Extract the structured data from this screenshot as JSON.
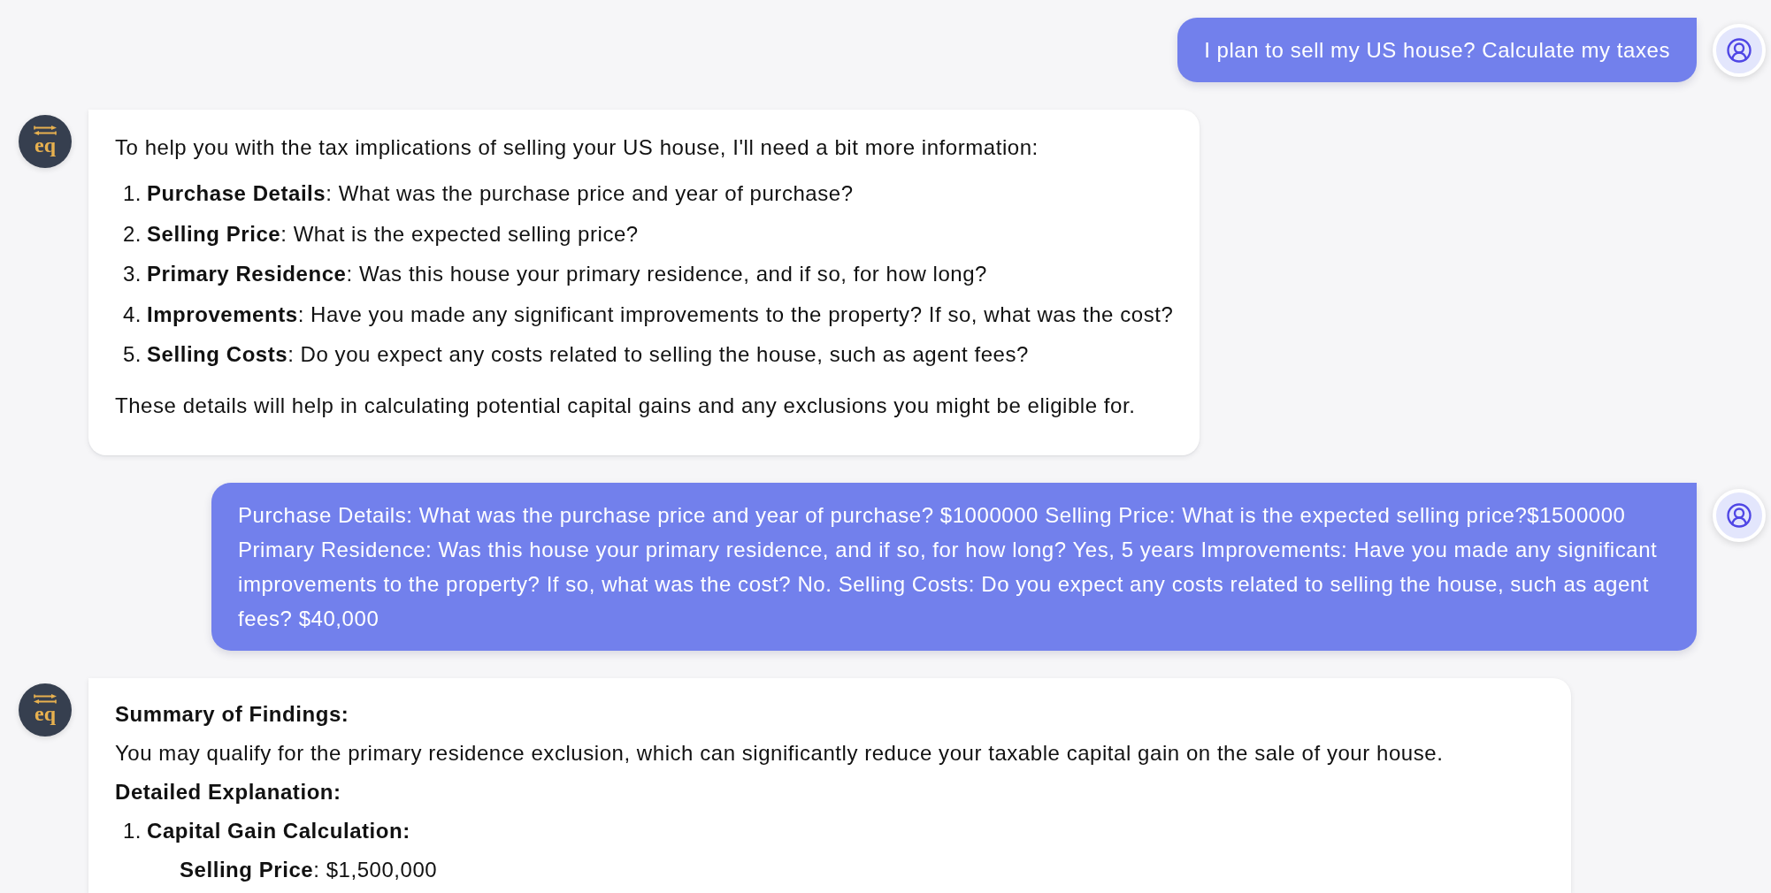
{
  "messages": [
    {
      "kind": "user",
      "text": "I plan to sell my US house? Calculate my taxes"
    },
    {
      "kind": "assistant",
      "avatar": {
        "logo_text": "eq"
      },
      "blocks": [
        {
          "kind": "paragraph",
          "text": "To help you with the tax implications of selling your US house, I'll need a bit more information:"
        },
        {
          "kind": "ordered_list",
          "items": [
            {
              "marker": "1.",
              "bold": false,
              "text": "**Purchase Details**: What was the purchase price and year of purchase?"
            },
            {
              "marker": "2.",
              "bold": false,
              "text": "**Selling Price**: What is the expected selling price?"
            },
            {
              "marker": "3.",
              "bold": false,
              "text": "**Primary Residence**: Was this house your primary residence, and if so, for how long?"
            },
            {
              "marker": "4.",
              "bold": false,
              "text": "**Improvements**: Have you made any significant improvements to the property? If so, what was the cost?"
            },
            {
              "marker": "5.",
              "bold": false,
              "text": "**Selling Costs**: Do you expect any costs related to selling the house, such as agent fees?"
            }
          ]
        },
        {
          "kind": "paragraph",
          "text": "These details will help in calculating potential capital gains and any exclusions you might be eligible for."
        }
      ]
    },
    {
      "kind": "user",
      "text": "Purchase Details: What was the purchase price and year of purchase? $1000000 Selling Price: What is the expected selling price?$1500000 Primary Residence: Was this house your primary residence, and if so, for how long? Yes, 5 years Improvements: Have you made any significant improvements to the property? If so, what was the cost? No. Selling Costs: Do you expect any costs related to selling the house, such as agent fees? $40,000"
    },
    {
      "kind": "assistant",
      "avatar": {
        "logo_text": "eq"
      },
      "blocks": [
        {
          "kind": "heading",
          "text": "Summary of Findings:"
        },
        {
          "kind": "paragraph",
          "text": "You may qualify for the primary residence exclusion, which can significantly reduce your taxable capital gain on the sale of your house."
        },
        {
          "kind": "heading",
          "text": "Detailed Explanation:"
        },
        {
          "kind": "ordered_list",
          "items": [
            {
              "marker": "1.",
              "bold": true,
              "text": "Capital Gain Calculation:",
              "children": [
                {
                  "text": "**Selling Price**: $1,500,000"
                }
              ]
            }
          ]
        }
      ]
    }
  ]
}
